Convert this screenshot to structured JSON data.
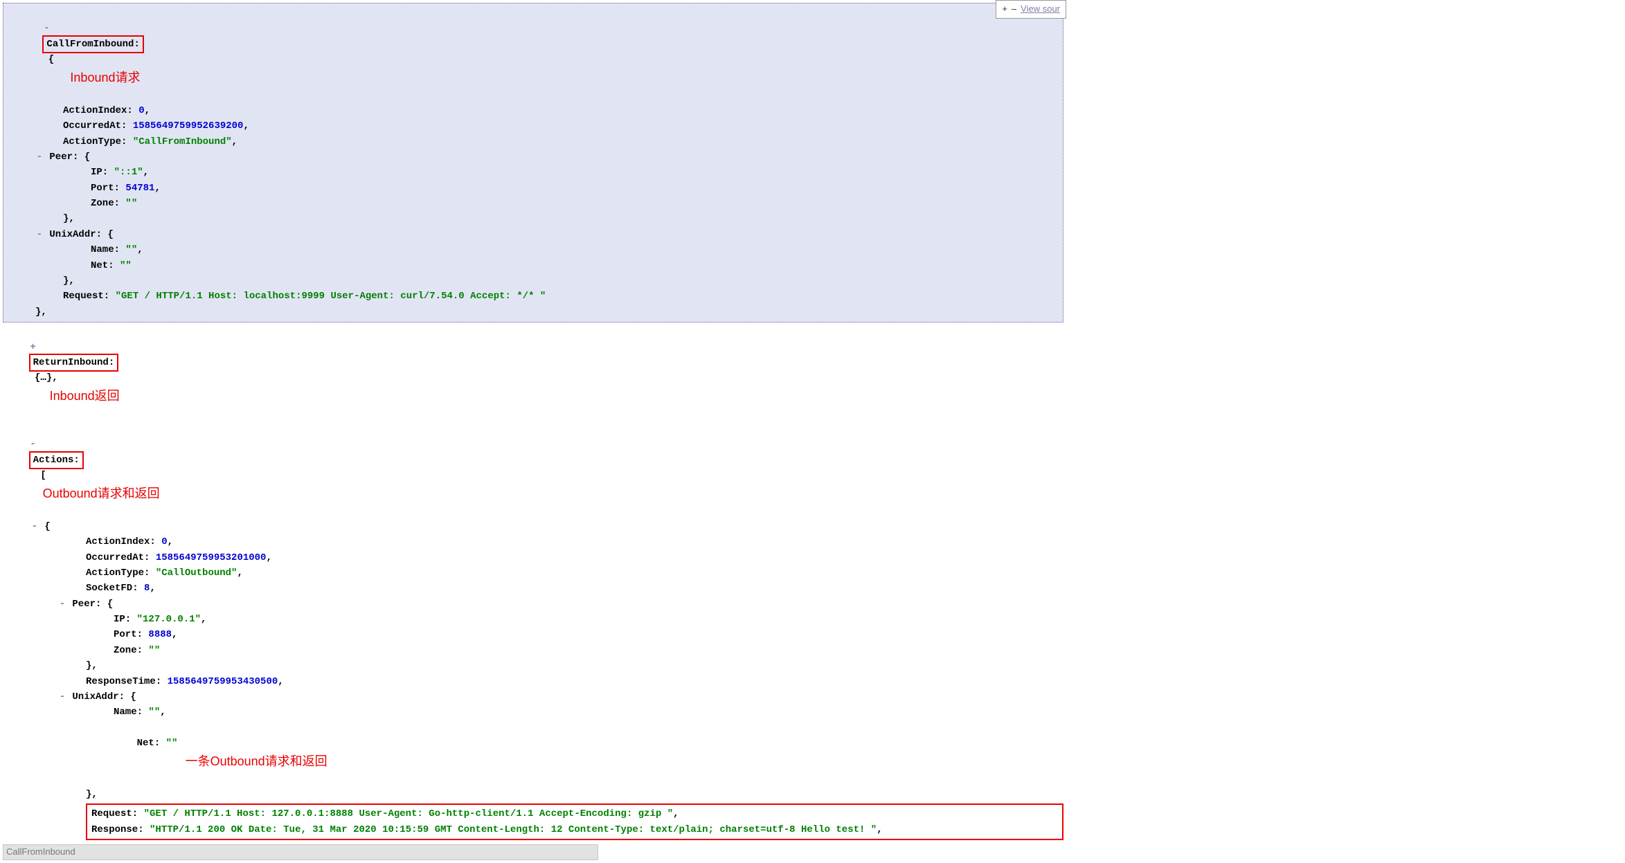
{
  "topbar": {
    "plus": "+",
    "minus": "–",
    "view_source": "View sour"
  },
  "annotations": {
    "call_from_inbound": "Inbound请求",
    "return_inbound": "Inbound返回",
    "actions": "Outbound请求和返回",
    "one_outbound": "一条Outbound请求和返回"
  },
  "toggles": {
    "minus": "-",
    "plus": "+"
  },
  "cfi": {
    "key": "CallFromInbound:",
    "action_index_k": "ActionIndex:",
    "action_index_v": "0",
    "occurred_at_k": "OccurredAt:",
    "occurred_at_v": "1585649759952639200",
    "action_type_k": "ActionType:",
    "action_type_v": "\"CallFromInbound\"",
    "peer_k": "Peer:",
    "ip_k": "IP:",
    "ip_v": "\"::1\"",
    "port_k": "Port:",
    "port_v": "54781",
    "zone_k": "Zone:",
    "zone_v": "\"\"",
    "unix_k": "UnixAddr:",
    "name_k": "Name:",
    "name_v": "\"\"",
    "net_k": "Net:",
    "net_v": "\"\"",
    "request_k": "Request:",
    "request_v": "\"GET / HTTP/1.1 Host: localhost:9999 User-Agent: curl/7.54.0 Accept: */* \""
  },
  "ri": {
    "key": "ReturnInbound:",
    "collapsed": "{…},"
  },
  "actions": {
    "key": "Actions:",
    "action_index_k": "ActionIndex:",
    "action_index_v": "0",
    "occurred_at_k": "OccurredAt:",
    "occurred_at_v": "1585649759953201000",
    "action_type_k": "ActionType:",
    "action_type_v": "\"CallOutbound\"",
    "socket_fd_k": "SocketFD:",
    "socket_fd_v": "8",
    "peer_k": "Peer:",
    "ip_k": "IP:",
    "ip_v": "\"127.0.0.1\"",
    "port_k": "Port:",
    "port_v": "8888",
    "zone_k": "Zone:",
    "zone_v": "\"\"",
    "response_time_k": "ResponseTime:",
    "response_time_v": "1585649759953430500",
    "unix_k": "UnixAddr:",
    "name_k": "Name:",
    "name_v": "\"\"",
    "net_k": "Net:",
    "net_v": "\"\"",
    "request_k": "Request:",
    "request_v": "\"GET / HTTP/1.1 Host: 127.0.0.1:8888 User-Agent: Go-http-client/1.1 Accept-Encoding: gzip \"",
    "response_k": "Response:",
    "response_v": "\"HTTP/1.1 200 OK Date: Tue, 31 Mar 2020 10:15:59 GMT Content-Length: 12 Content-Type: text/plain; charset=utf-8 Hello test! \""
  },
  "tooltip": "CallFromInbound"
}
